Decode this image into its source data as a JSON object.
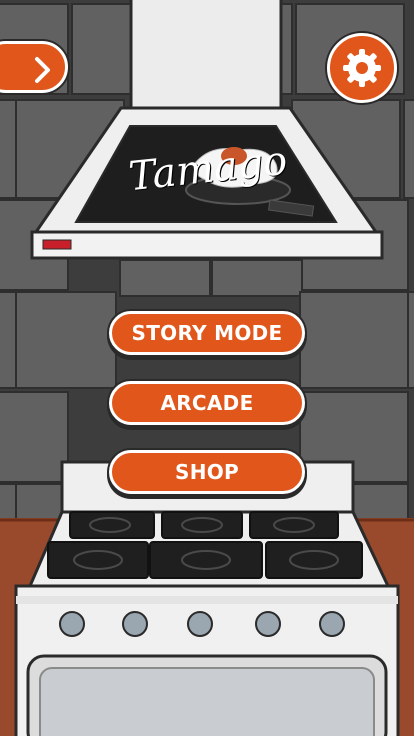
{
  "logo": {
    "text": "Tamago"
  },
  "menu": {
    "story_mode_label": "STORY MODE",
    "arcade_label": "ARCADE",
    "shop_label": "SHOP"
  },
  "icons": {
    "back": "chevron-right-icon",
    "settings": "gear-icon"
  },
  "colors": {
    "accent": "#e0561b",
    "tile": "#5b5b5b",
    "grout": "#3a3a3a",
    "counter": "#9a4a2c",
    "stove": "#efefef"
  }
}
